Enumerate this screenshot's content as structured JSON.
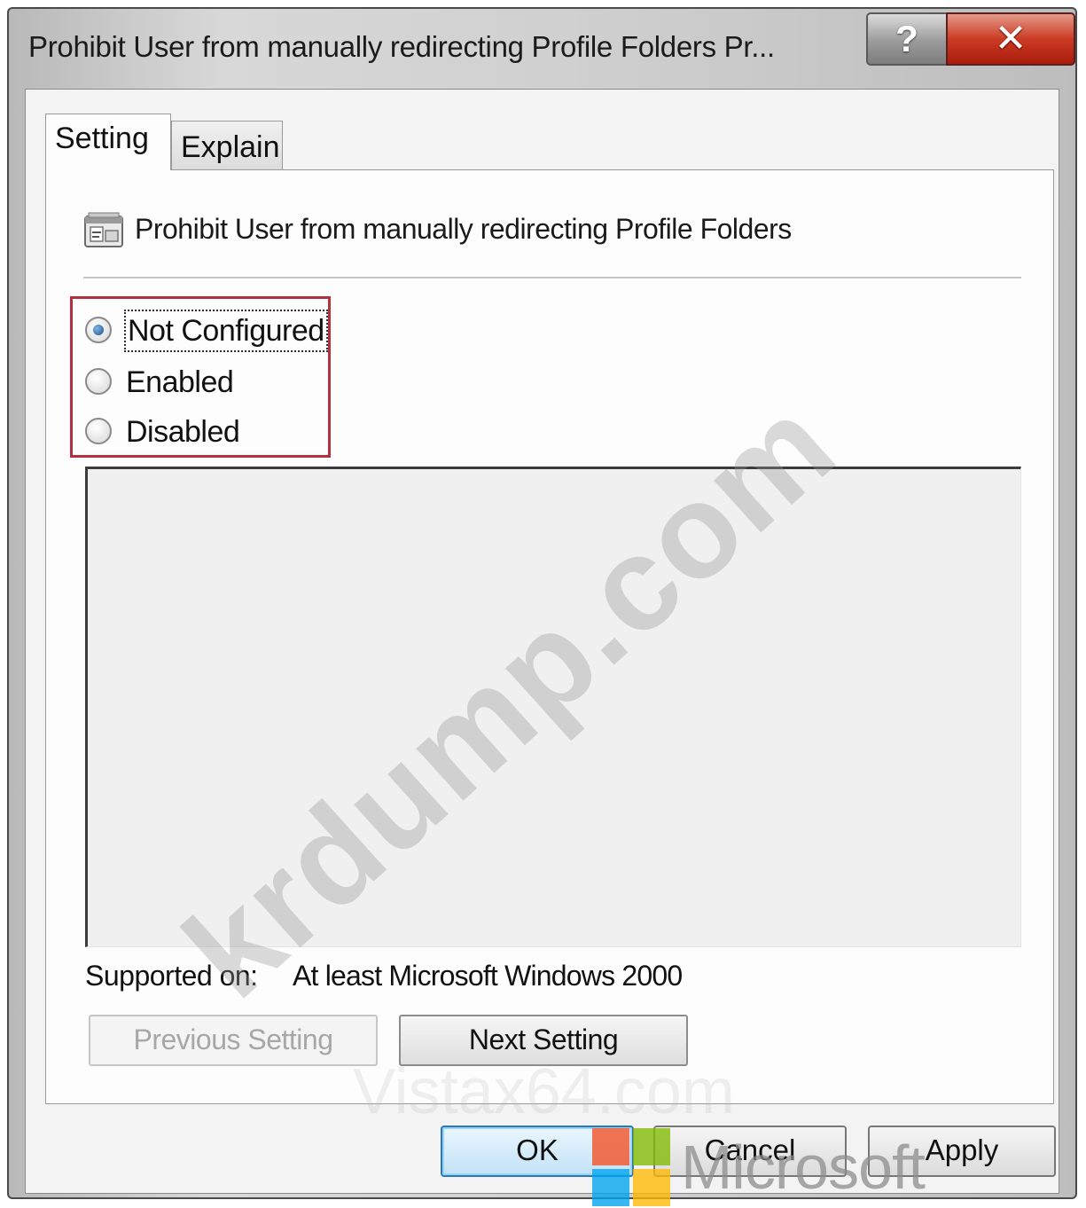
{
  "window": {
    "title": "Prohibit User from manually redirecting Profile Folders Pr...",
    "help_label": "?",
    "close_label": "✕"
  },
  "tabs": [
    {
      "label": "Setting",
      "active": true
    },
    {
      "label": "Explain",
      "active": false
    }
  ],
  "policy": {
    "icon": "policy-setting-icon",
    "title": "Prohibit User from manually redirecting Profile Folders"
  },
  "options": [
    {
      "label": "Not Configured",
      "checked": true
    },
    {
      "label": "Enabled",
      "checked": false
    },
    {
      "label": "Disabled",
      "checked": false
    }
  ],
  "supported": {
    "label": "Supported on:",
    "value": "At least Microsoft Windows 2000"
  },
  "navigation": {
    "previous_label": "Previous Setting",
    "previous_enabled": false,
    "next_label": "Next Setting"
  },
  "buttons": {
    "ok": "OK",
    "cancel": "Cancel",
    "apply": "Apply"
  },
  "watermarks": {
    "site": "krdump.com",
    "vistax": "Vistax64.com",
    "microsoft": "Microsoft"
  },
  "colors": {
    "highlight_border": "#b4303f",
    "close_button": "#cc3b24",
    "ok_button_border": "#2b78b4"
  }
}
